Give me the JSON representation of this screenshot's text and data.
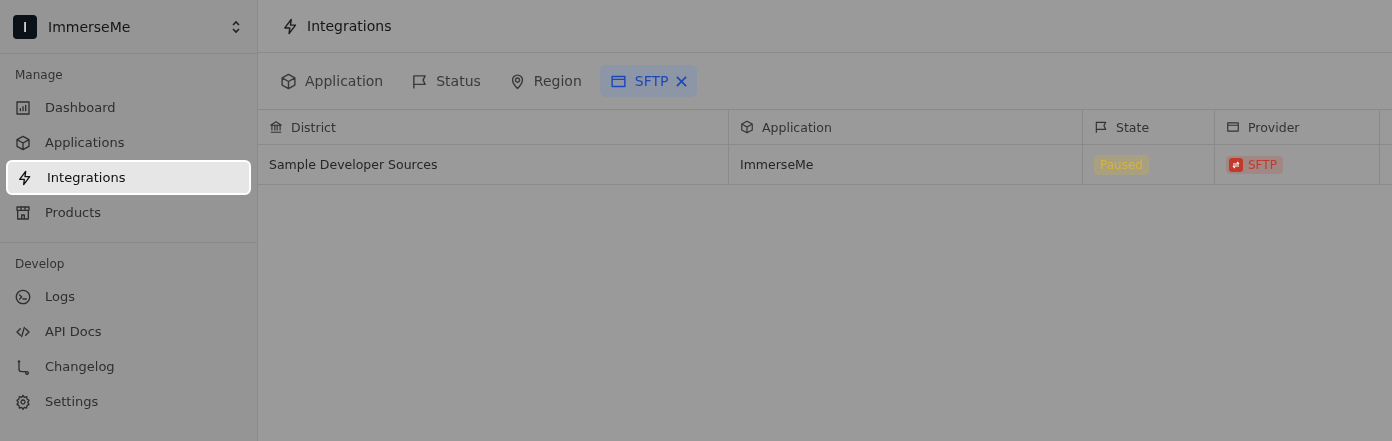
{
  "workspace": {
    "initial": "I",
    "name": "ImmerseMe"
  },
  "sidebar": {
    "sections": [
      {
        "title": "Manage",
        "items": [
          {
            "label": "Dashboard",
            "kind": "chart",
            "selected": false
          },
          {
            "label": "Applications",
            "kind": "cube",
            "selected": false
          },
          {
            "label": "Integrations",
            "kind": "bolt",
            "selected": true
          },
          {
            "label": "Products",
            "kind": "store",
            "selected": false
          }
        ]
      },
      {
        "title": "Develop",
        "items": [
          {
            "label": "Logs",
            "kind": "terminal",
            "selected": false
          },
          {
            "label": "API Docs",
            "kind": "code",
            "selected": false
          },
          {
            "label": "Changelog",
            "kind": "branch",
            "selected": false
          },
          {
            "label": "Settings",
            "kind": "gear",
            "selected": false
          }
        ]
      }
    ]
  },
  "page": {
    "title": "Integrations",
    "kind": "bolt"
  },
  "filters": [
    {
      "label": "Application",
      "kind": "cube",
      "selected": false
    },
    {
      "label": "Status",
      "kind": "flag",
      "selected": false
    },
    {
      "label": "Region",
      "kind": "pin",
      "selected": false
    },
    {
      "label": "SFTP",
      "kind": "window",
      "selected": true
    }
  ],
  "table": {
    "columns": [
      {
        "label": "District",
        "kind": "bank"
      },
      {
        "label": "Application",
        "kind": "cube"
      },
      {
        "label": "State",
        "kind": "flag"
      },
      {
        "label": "Provider",
        "kind": "window"
      }
    ],
    "rows": [
      {
        "district": "Sample Developer Sources",
        "application": "ImmerseMe",
        "state": {
          "text": "Paused",
          "color": "#d6b43a"
        },
        "provider": {
          "text": "SFTP",
          "color": "#c0392b"
        }
      }
    ]
  }
}
